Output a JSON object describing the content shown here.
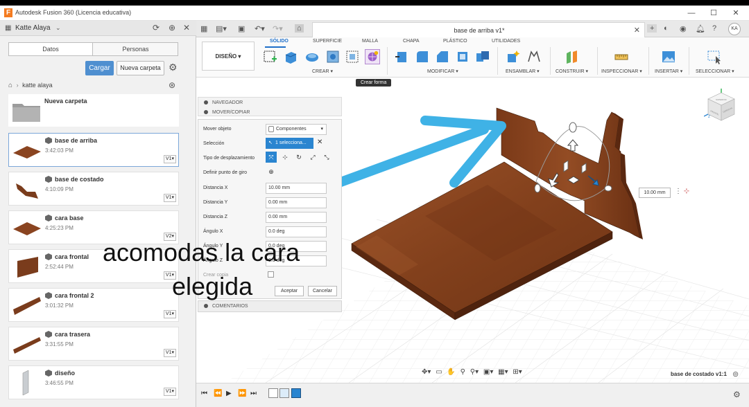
{
  "window": {
    "title": "Autodesk Fusion 360 (Licencia educativa)",
    "logo": "F",
    "minimize": "—",
    "maximize": "☐",
    "close": "✕"
  },
  "data_panel": {
    "user": "Katte Alaya",
    "tabs": [
      "Datos",
      "Personas"
    ],
    "upload_label": "Cargar",
    "new_folder_label": "Nueva carpeta",
    "breadcrumb": "katte alaya",
    "folder": {
      "name": "Nueva carpeta"
    },
    "files": [
      {
        "name": "base de arriba",
        "time": "3:42:03 PM",
        "version": "V1▾"
      },
      {
        "name": "base de costado",
        "time": "4:10:09 PM",
        "version": "V1▾"
      },
      {
        "name": "cara base",
        "time": "4:25:23 PM",
        "version": "V2▾"
      },
      {
        "name": "cara frontal",
        "time": "2:52:44 PM",
        "version": "V1▾"
      },
      {
        "name": "cara frontal 2",
        "time": "3:01:32 PM",
        "version": "V1▾"
      },
      {
        "name": "cara trasera",
        "time": "3:31:55 PM",
        "version": "V1▾"
      },
      {
        "name": "diseño",
        "time": "3:46:55 PM",
        "version": "V1▾"
      }
    ]
  },
  "document": {
    "tab_title": "base de arriba v1*",
    "avatar": "KA"
  },
  "toolbar": {
    "workspace": "DISEÑO ▾",
    "tabs": [
      "SÓLIDO",
      "SUPERFICIE",
      "MALLA",
      "CHAPA",
      "PLÁSTICO",
      "UTILIDADES"
    ],
    "groups": [
      "CREAR ▾",
      "MODIFICAR ▾",
      "ENSAMBLAR ▾",
      "CONSTRUIR ▾",
      "INSPECCIONAR ▾",
      "INSERTAR ▾",
      "SELECCIONAR ▾"
    ],
    "tooltip": "Crear forma"
  },
  "browser": {
    "navigator": "NAVEGADOR",
    "move_copy": "MOVER/COPIAR"
  },
  "move_dialog": {
    "labels": {
      "move_object": "Mover objeto",
      "selection": "Selección",
      "move_type": "Tipo de desplazamiento",
      "pivot": "Definir punto de giro",
      "dist_x": "Distancia X",
      "dist_y": "Distancia Y",
      "dist_z": "Distancia Z",
      "angle_x": "Ángulo X",
      "angle_y": "Ángulo Y",
      "angle_z": "Ángulo Z",
      "create_copy": "Crear copia"
    },
    "move_object_value": "Componentes",
    "selection_value": "1 selecciona...",
    "values": {
      "dist_x": "10.00 mm",
      "dist_y": "0.00 mm",
      "dist_z": "0.00 mm",
      "angle_x": "0.0 deg",
      "angle_y": "0.0 deg",
      "angle_z": "0.0 deg"
    },
    "ok_label": "Aceptar",
    "cancel_label": "Cancelar",
    "comments": "COMENTARIOS"
  },
  "viewport": {
    "dim_value": "10.00 mm",
    "status_name": "base de costado v1:1",
    "viewcube_labels": [
      "SUPERIOR",
      "FRONTAL",
      "DERECHA"
    ]
  },
  "annotation": {
    "line1": "acomodas  la cara",
    "line2": "elegida"
  },
  "colors": {
    "accent": "#1e6fc9",
    "arrow": "#3fb2e6",
    "wood": "#8a4420",
    "button_blue": "#4f8fd0"
  }
}
